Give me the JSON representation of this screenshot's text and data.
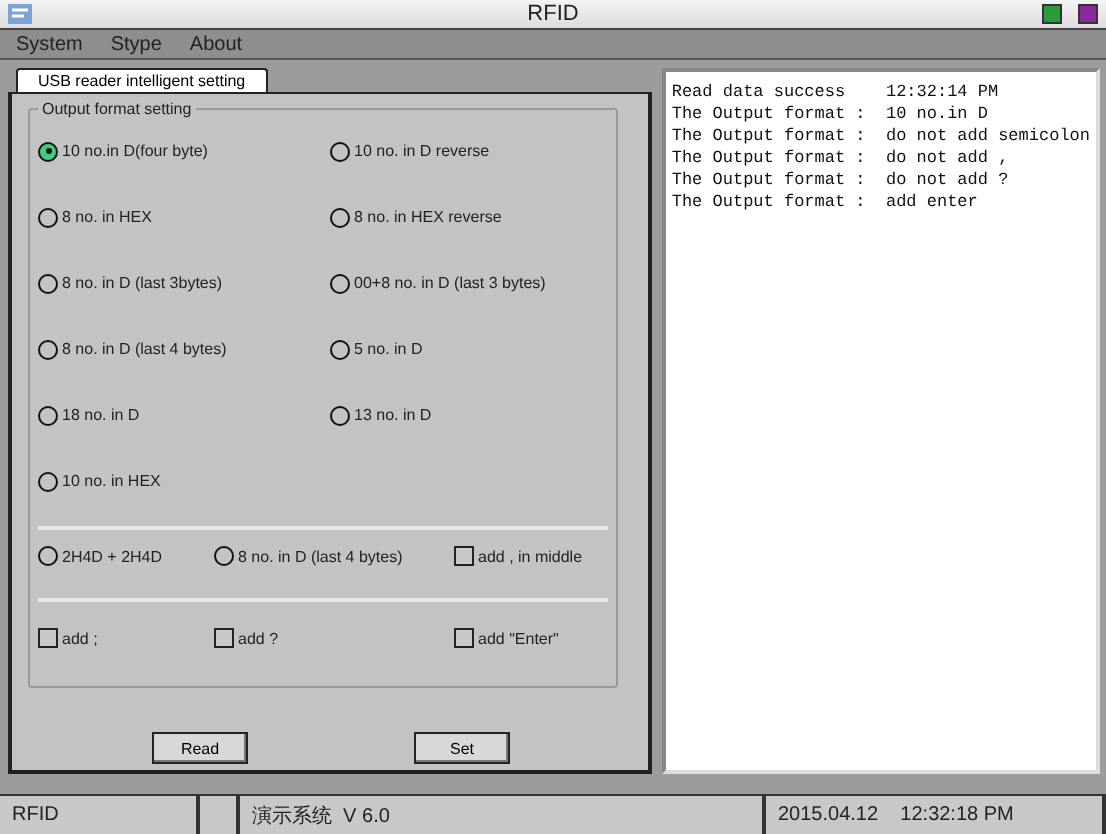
{
  "window": {
    "title": "RFID"
  },
  "menu": [
    {
      "label": "System"
    },
    {
      "label": "Stype"
    },
    {
      "label": "About"
    }
  ],
  "tab": {
    "label": "USB reader intelligent setting",
    "selected": true
  },
  "group": {
    "title": "Output format setting"
  },
  "formats": [
    {
      "label": "10 no.in D(four byte)",
      "selected": true
    },
    {
      "label": "10 no. in D reverse",
      "selected": false
    },
    {
      "label": "8 no. in HEX",
      "selected": false
    },
    {
      "label": "8 no. in HEX reverse",
      "selected": false
    },
    {
      "label": "8 no. in D (last 3bytes)",
      "selected": false
    },
    {
      "label": "00+8 no. in D (last 3 bytes)",
      "selected": false
    },
    {
      "label": "8 no. in D (last 4 bytes)",
      "selected": false
    },
    {
      "label": "5 no. in D",
      "selected": false
    },
    {
      "label": "18 no. in D",
      "selected": false
    },
    {
      "label": "13 no. in D",
      "selected": false
    },
    {
      "label": "10 no. in HEX",
      "selected": false
    }
  ],
  "extra_row": [
    {
      "kind": "radio",
      "label": "2H4D + 2H4D",
      "selected": false
    },
    {
      "kind": "radio",
      "label": "8 no. in D (last 4 bytes)",
      "selected": false
    },
    {
      "kind": "checkbox",
      "label": "add , in middle",
      "checked": false
    }
  ],
  "options_row": [
    {
      "kind": "checkbox",
      "label": "add ;",
      "checked": false
    },
    {
      "kind": "checkbox",
      "label": "add ?",
      "checked": false
    },
    {
      "kind": "checkbox",
      "label": "add \"Enter\"",
      "checked": false
    }
  ],
  "buttons": [
    {
      "label": "Read"
    },
    {
      "label": "Set"
    }
  ],
  "log": [
    "Read data success    12:32:14 PM",
    "The Output format :  10 no.in D",
    "The Output format :  do not add semicolon",
    "The Output format :  do not add ,",
    "The Output format :  do not add ?",
    "The Output format :  add enter"
  ],
  "status_bar": [
    "RFID",
    "演示系统  V 6.0",
    "2015.04.12    12:32:18 PM"
  ]
}
